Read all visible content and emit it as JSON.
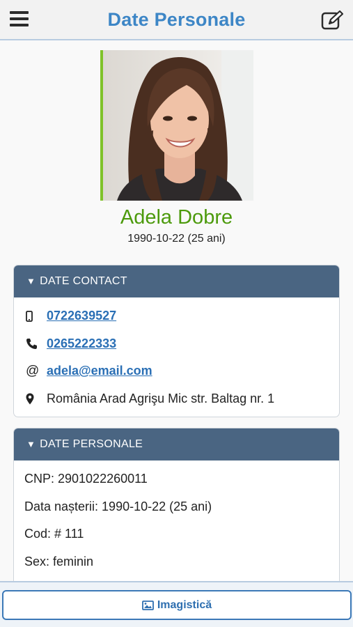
{
  "header": {
    "title": "Date Personale"
  },
  "profile": {
    "name": "Adela Dobre",
    "dob": "1990-10-22 (25 ani)"
  },
  "contact": {
    "heading": "DATE CONTACT",
    "mobile": "0722639527",
    "phone": "0265222333",
    "email": "adela@email.com",
    "address": "România Arad Agrişu Mic str. Baltag nr. 1"
  },
  "personal": {
    "heading": "DATE PERSONALE",
    "cnp": "CNP: 2901022260011",
    "birth": "Data nașterii: 1990-10-22 (25 ani)",
    "cod": "Cod: # 111",
    "sex": "Sex: feminin"
  },
  "footer": {
    "button_label": "Imagistică"
  },
  "colors": {
    "accent": "#3d86c6",
    "name": "#4c9a0c",
    "panel_head": "#4a6582",
    "photo_border": "#7fc229"
  }
}
